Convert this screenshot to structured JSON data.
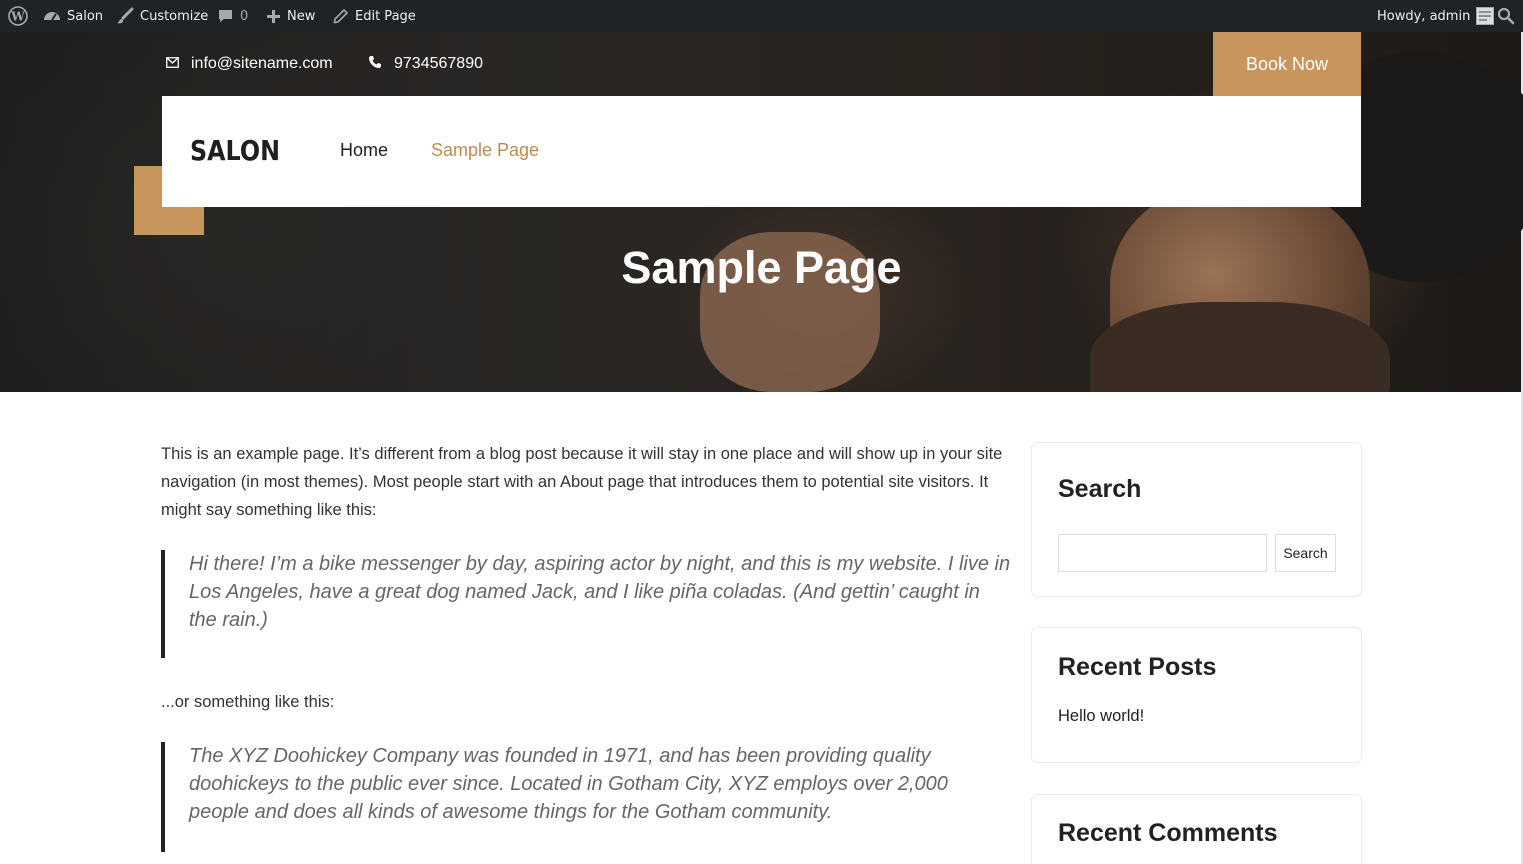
{
  "admin_bar": {
    "site_name": "Salon",
    "customize": "Customize",
    "comments_count": "0",
    "new": "New",
    "edit_page": "Edit Page",
    "howdy": "Howdy, admin"
  },
  "header": {
    "email": "info@sitename.com",
    "phone": "9734567890",
    "book_button": "Book Now",
    "logo": "SALON",
    "nav": [
      {
        "label": "Home",
        "active": false
      },
      {
        "label": "Sample Page",
        "active": true
      }
    ],
    "accent_color": "#c8955c"
  },
  "hero": {
    "title": "Sample Page"
  },
  "content": {
    "intro": "This is an example page. It’s different from a blog post because it will stay in one place and will show up in your site navigation (in most themes). Most people start with an About page that introduces them to potential site visitors. It might say something like this:",
    "quote1": "Hi there! I’m a bike messenger by day, aspiring actor by night, and this is my website. I live in Los Angeles, have a great dog named Jack, and I like piña coladas. (And gettin’ caught in the rain.)",
    "middle": "...or something like this:",
    "quote2": "The XYZ Doohickey Company was founded in 1971, and has been providing quality doohickeys to the public ever since. Located in Gotham City, XYZ employs over 2,000 people and does all kinds of awesome things for the Gotham community."
  },
  "sidebar": {
    "search": {
      "title": "Search",
      "button": "Search",
      "value": ""
    },
    "recent_posts": {
      "title": "Recent Posts",
      "items": [
        "Hello world!"
      ]
    },
    "recent_comments": {
      "title": "Recent Comments"
    }
  }
}
